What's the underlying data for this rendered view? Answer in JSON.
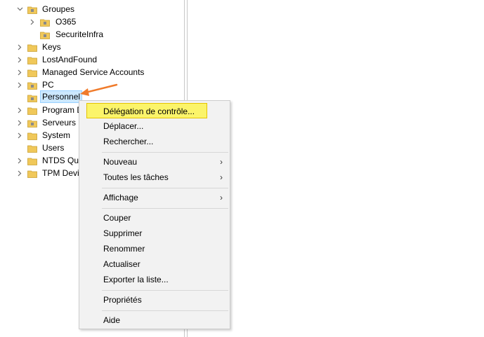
{
  "tree": {
    "items": [
      {
        "label": "Groupes",
        "expanded": true
      },
      {
        "label": "O365",
        "expanded": false
      },
      {
        "label": "SecuriteInfra"
      },
      {
        "label": "Keys",
        "expanded": false
      },
      {
        "label": "LostAndFound",
        "expanded": false
      },
      {
        "label": "Managed Service Accounts",
        "expanded": false
      },
      {
        "label": "PC",
        "expanded": false
      },
      {
        "label": "Personnel",
        "selected": true
      },
      {
        "label": "Program D",
        "expanded": false
      },
      {
        "label": "Serveurs",
        "expanded": false
      },
      {
        "label": "System",
        "expanded": false
      },
      {
        "label": "Users"
      },
      {
        "label": "NTDS Quo",
        "expanded": false
      },
      {
        "label": "TPM Devi",
        "expanded": false
      }
    ]
  },
  "context_menu": {
    "items": [
      {
        "label": "Délégation de contrôle...",
        "highlighted": true
      },
      {
        "label": "Déplacer..."
      },
      {
        "label": "Rechercher..."
      },
      {
        "label": "Nouveau",
        "submenu": true
      },
      {
        "label": "Toutes les tâches",
        "submenu": true
      },
      {
        "label": "Affichage",
        "submenu": true
      },
      {
        "label": "Couper"
      },
      {
        "label": "Supprimer"
      },
      {
        "label": "Renommer"
      },
      {
        "label": "Actualiser"
      },
      {
        "label": "Exporter la liste..."
      },
      {
        "label": "Propriétés"
      },
      {
        "label": "Aide"
      }
    ],
    "submenu_arrow": "›"
  },
  "colors": {
    "selection_bg": "#cce8ff",
    "highlight_bg": "#fbf46a",
    "annotation_arrow": "#f07b2b"
  },
  "icons": {
    "folder": "ou-folder-icon",
    "expand": "chevron-right-icon",
    "collapse": "chevron-down-icon"
  }
}
